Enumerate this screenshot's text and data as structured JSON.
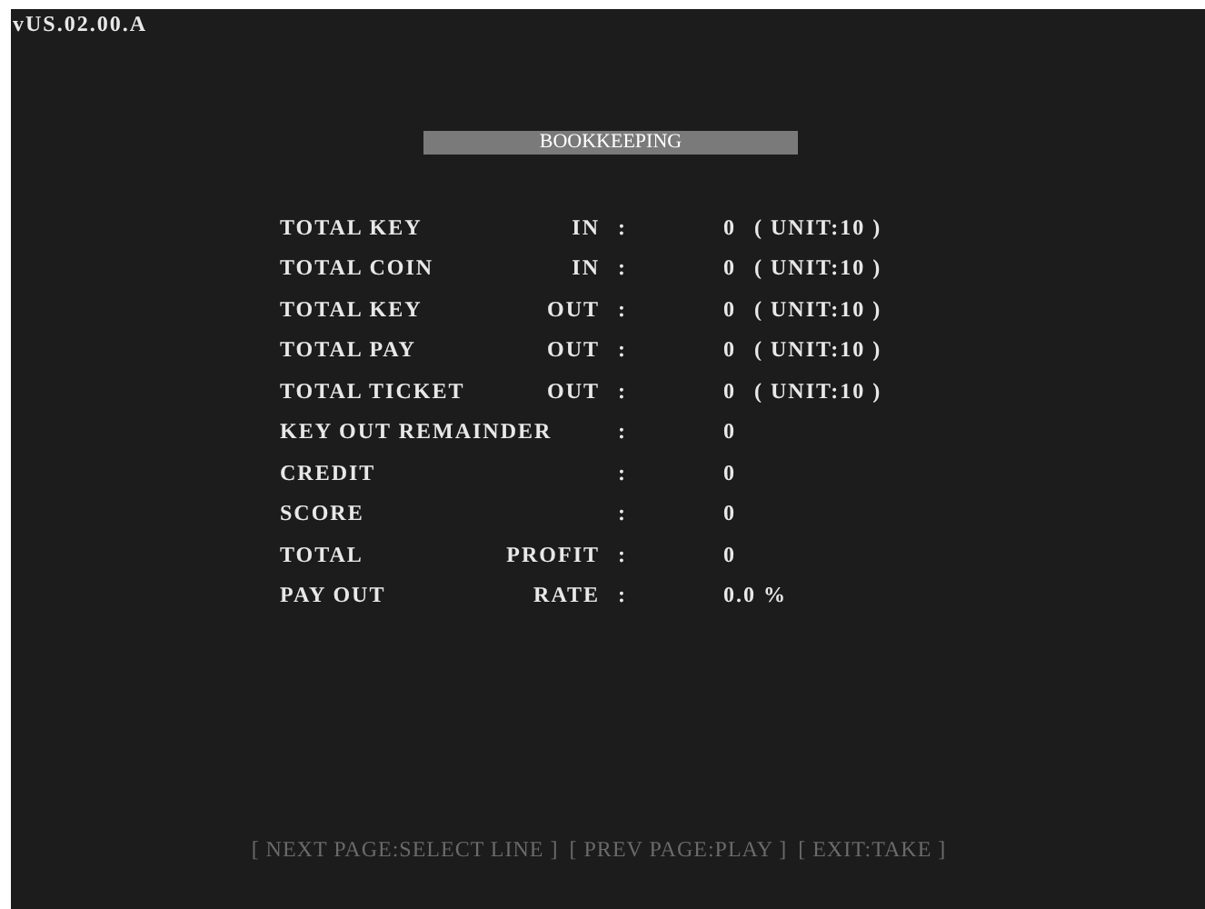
{
  "version": "vUS.02.00.A",
  "title": "BOOKKEEPING",
  "rows": [
    {
      "label": "TOTAL KEY",
      "label_right": "IN",
      "colon": ":",
      "value": "0",
      "unit": "( UNIT:10 )"
    },
    {
      "label": "TOTAL COIN",
      "label_right": "IN",
      "colon": ":",
      "value": "0",
      "unit": "( UNIT:10 )"
    },
    {
      "label": "TOTAL KEY",
      "label_right": "OUT",
      "colon": ":",
      "value": "0",
      "unit": "( UNIT:10 )"
    },
    {
      "label": "TOTAL PAY",
      "label_right": "OUT",
      "colon": ":",
      "value": "0",
      "unit": "( UNIT:10 )"
    },
    {
      "label": "TOTAL TICKET",
      "label_right": "OUT",
      "colon": ":",
      "value": "0",
      "unit": "( UNIT:10 )"
    },
    {
      "label": "KEY OUT REMAINDER",
      "colon": ":",
      "value": "0"
    },
    {
      "label": "CREDIT",
      "colon": ":",
      "value": "0"
    },
    {
      "label": "SCORE",
      "colon": ":",
      "value": "0"
    },
    {
      "label": "TOTAL",
      "label_right": "PROFIT",
      "colon": ":",
      "value": "0"
    },
    {
      "label": "PAY OUT",
      "label_right": "RATE",
      "colon": ":",
      "value": "0.0 %"
    }
  ],
  "footer_hints": [
    "[ NEXT PAGE:SELECT LINE ]",
    "[ PREV PAGE:PLAY ]",
    "[ EXIT:TAKE ]"
  ]
}
